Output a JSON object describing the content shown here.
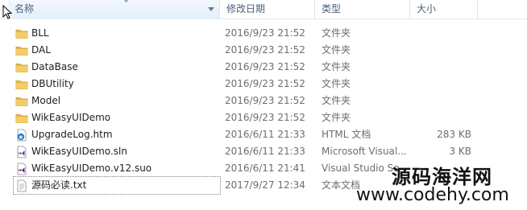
{
  "columns": {
    "name": "名称",
    "modified": "修改日期",
    "type": "类型",
    "size": "大小"
  },
  "colors": {
    "header_text": "#4c607a",
    "folder": "#e8b84a",
    "secondary_text": "#6d6d6d"
  },
  "files": [
    {
      "name": "BLL",
      "modified": "2016/9/23 21:52",
      "type": "文件夹",
      "size": "",
      "icon": "folder-icon"
    },
    {
      "name": "DAL",
      "modified": "2016/9/23 21:52",
      "type": "文件夹",
      "size": "",
      "icon": "folder-icon"
    },
    {
      "name": "DataBase",
      "modified": "2016/9/23 21:52",
      "type": "文件夹",
      "size": "",
      "icon": "folder-icon"
    },
    {
      "name": "DBUtility",
      "modified": "2016/9/23 21:52",
      "type": "文件夹",
      "size": "",
      "icon": "folder-icon"
    },
    {
      "name": "Model",
      "modified": "2016/9/23 21:52",
      "type": "文件夹",
      "size": "",
      "icon": "folder-icon"
    },
    {
      "name": "WikEasyUIDemo",
      "modified": "2016/9/23 21:52",
      "type": "文件夹",
      "size": "",
      "icon": "folder-icon"
    },
    {
      "name": "UpgradeLog.htm",
      "modified": "2016/6/11 21:33",
      "type": "HTML 文档",
      "size": "283 KB",
      "icon": "html-file-icon"
    },
    {
      "name": "WikEasyUIDemo.sln",
      "modified": "2016/6/11 21:33",
      "type": "Microsoft Visual...",
      "size": "3 KB",
      "icon": "vs-solution-icon"
    },
    {
      "name": "WikEasyUIDemo.v12.suo",
      "modified": "2016/6/11 21:41",
      "type": "Visual Studio So",
      "size": "",
      "icon": "vs-suo-icon"
    },
    {
      "name": "源码必读.txt",
      "modified": "2017/9/27 12:34",
      "type": "文本文档",
      "size": "",
      "icon": "text-file-icon"
    }
  ],
  "watermark": {
    "title": "源码海洋网",
    "url": "www.codehy.com"
  }
}
